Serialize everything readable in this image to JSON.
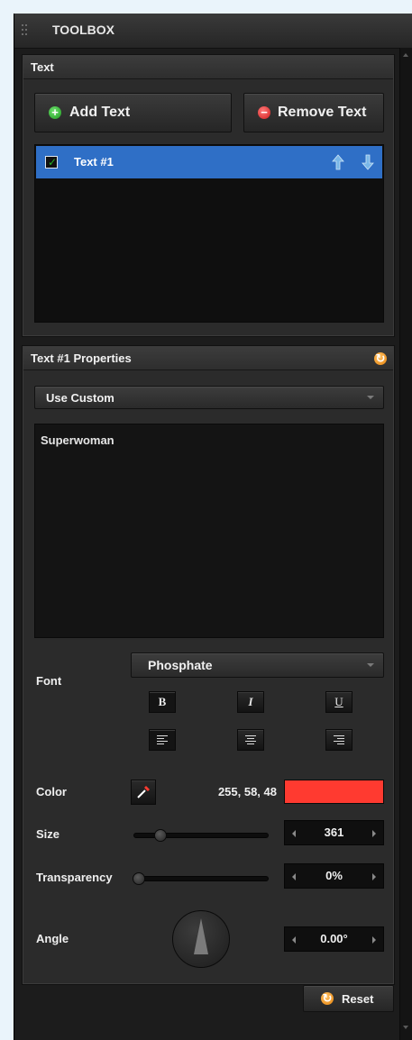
{
  "window": {
    "title": "TOOLBOX"
  },
  "text_panel": {
    "title": "Text",
    "add_label": "Add Text",
    "add_icon": "plus-circle-icon",
    "remove_label": "Remove Text",
    "remove_icon": "minus-circle-icon",
    "items": [
      {
        "label": "Text #1",
        "checked": true,
        "selected": true
      }
    ]
  },
  "properties": {
    "title": "Text #1 Properties",
    "preset": "Use Custom",
    "text_value": "Superwoman",
    "font_label": "Font",
    "font_value": "Phosphate",
    "bold_glyph": "B",
    "italic_glyph": "I",
    "underline_glyph": "U",
    "color_label": "Color",
    "color_rgb": "255, 58, 48",
    "color_hex": "#ff3a30",
    "size_label": "Size",
    "size_value": "361",
    "transparency_label": "Transparency",
    "transparency_value": "0%",
    "angle_label": "Angle",
    "angle_value": "0.00°"
  },
  "footer": {
    "reset_label": "Reset"
  },
  "colors": {
    "selection": "#2f6fc6",
    "accent_green": "#25b325",
    "accent_orange": "#e5820b"
  }
}
